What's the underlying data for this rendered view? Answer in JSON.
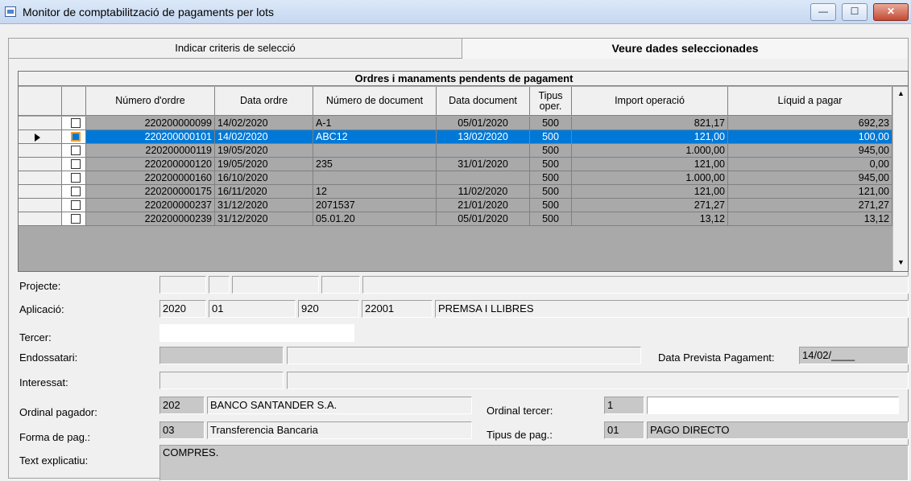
{
  "window": {
    "title": "Monitor de comptabilització de pagaments per lots",
    "min_glyph": "—",
    "max_glyph": "☐",
    "close_glyph": "✕"
  },
  "tabs": [
    {
      "label": "Indicar criteris de selecció",
      "active": false
    },
    {
      "label": "Veure dades seleccionades",
      "active": true
    }
  ],
  "grid": {
    "caption": "Ordres i manaments pendents de pagament",
    "columns": [
      "Número d'ordre",
      "Data ordre",
      "Número de document",
      "Data document",
      "Tipus oper.",
      "Import operació",
      "Líquid a pagar"
    ],
    "rows": [
      {
        "order": "220200000099",
        "date": "14/02/2020",
        "doc": "A-1",
        "docdate": "05/01/2020",
        "tipus": "500",
        "import": "821,17",
        "liquid": "692,23",
        "selected": false
      },
      {
        "order": "220200000101",
        "date": "14/02/2020",
        "doc": "ABC12",
        "docdate": "13/02/2020",
        "tipus": "500",
        "import": "121,00",
        "liquid": "100,00",
        "selected": true
      },
      {
        "order": "220200000119",
        "date": "19/05/2020",
        "doc": "",
        "docdate": "",
        "tipus": "500",
        "import": "1.000,00",
        "liquid": "945,00",
        "selected": false
      },
      {
        "order": "220200000120",
        "date": "19/05/2020",
        "doc": "235",
        "docdate": "31/01/2020",
        "tipus": "500",
        "import": "121,00",
        "liquid": "0,00",
        "selected": false
      },
      {
        "order": "220200000160",
        "date": "16/10/2020",
        "doc": "",
        "docdate": "",
        "tipus": "500",
        "import": "1.000,00",
        "liquid": "945,00",
        "selected": false
      },
      {
        "order": "220200000175",
        "date": "16/11/2020",
        "doc": "12",
        "docdate": "11/02/2020",
        "tipus": "500",
        "import": "121,00",
        "liquid": "121,00",
        "selected": false
      },
      {
        "order": "220200000237",
        "date": "31/12/2020",
        "doc": "2071537",
        "docdate": "21/01/2020",
        "tipus": "500",
        "import": "271,27",
        "liquid": "271,27",
        "selected": false
      },
      {
        "order": "220200000239",
        "date": "31/12/2020",
        "doc": "05.01.20",
        "docdate": "05/01/2020",
        "tipus": "500",
        "import": "13,12",
        "liquid": "13,12",
        "selected": false
      }
    ],
    "scroll_up": "▲",
    "scroll_down": "▼"
  },
  "form": {
    "projecte": {
      "label": "Projecte:",
      "values": [
        "",
        "",
        "",
        "",
        ""
      ]
    },
    "aplicacio": {
      "label": "Aplicació:",
      "values": [
        "2020",
        "01",
        "920",
        "22001",
        "PREMSA I LLIBRES"
      ]
    },
    "tercer": {
      "label": "Tercer:",
      "value": ""
    },
    "endossatari": {
      "label": "Endossatari:",
      "values": [
        "",
        ""
      ]
    },
    "data_prevista": {
      "label": "Data Prevista Pagament:",
      "value": "14/02/____"
    },
    "interessat": {
      "label": "Interessat:",
      "values": [
        "",
        ""
      ]
    },
    "ordinal_pagador": {
      "label": "Ordinal pagador:",
      "code": "202",
      "name": "BANCO SANTANDER S.A."
    },
    "ordinal_tercer": {
      "label": "Ordinal tercer:",
      "code": "1",
      "name": ""
    },
    "forma_pag": {
      "label": "Forma de pag.:",
      "code": "03",
      "name": "Transferencia Bancaria"
    },
    "tipus_pag": {
      "label": "Tipus de pag.:",
      "code": "01",
      "name": "PAGO DIRECTO"
    },
    "text_explicatiu": {
      "label": "Text explicatiu:",
      "value": "COMPRES."
    }
  }
}
